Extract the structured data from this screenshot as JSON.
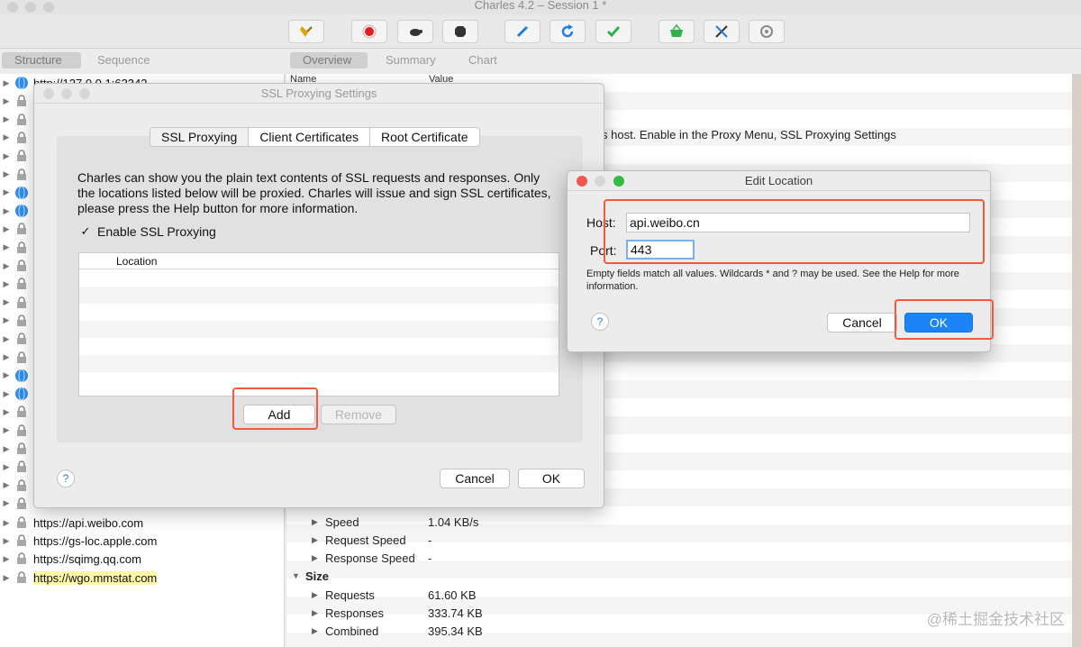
{
  "window": {
    "title": "Charles 4.2 – Session 1 *"
  },
  "toolbar": {
    "buttons": [
      {
        "name": "broom-icon",
        "color": "#e4a400"
      },
      {
        "name": "record-icon",
        "color": "#e02020"
      },
      {
        "name": "turtle-icon",
        "color": "#333333"
      },
      {
        "name": "stop-icon",
        "color": "#333333"
      },
      {
        "name": "pen-icon",
        "color": "#1d7ee0"
      },
      {
        "name": "refresh-icon",
        "color": "#1d7ee0"
      },
      {
        "name": "check-icon",
        "color": "#2db34a"
      },
      {
        "name": "basket-icon",
        "color": "#2db34a"
      },
      {
        "name": "tools-icon",
        "color": "#333333"
      },
      {
        "name": "settings-icon",
        "color": "#888888"
      }
    ]
  },
  "left_tabs": [
    "Structure",
    "Sequence"
  ],
  "right_tabs": [
    "Overview",
    "Summary",
    "Chart"
  ],
  "tree": {
    "top_item": "http://127.0.0.1:63342",
    "items": [
      {
        "label": "https://api.weibo.com",
        "icon": "lock-icon",
        "highlight": false
      },
      {
        "label": "https://gs-loc.apple.com",
        "icon": "lock-icon",
        "highlight": false
      },
      {
        "label": "https://sqimg.qq.com",
        "icon": "lock-icon",
        "highlight": false
      },
      {
        "label": "https://wgo.mmstat.com",
        "icon": "lock-icon",
        "highlight": true
      }
    ]
  },
  "overview": {
    "col_name": "Name",
    "col_value": "Value",
    "hint": "s host. Enable in the Proxy Menu, SSL Proxying Settings",
    "rows": [
      {
        "key": "Speed",
        "value": "1.04 KB/s",
        "level": 1
      },
      {
        "key": "Request Speed",
        "value": "-",
        "level": 1
      },
      {
        "key": "Response Speed",
        "value": "-",
        "level": 1
      },
      {
        "key": "Size",
        "value": "",
        "level": 0
      },
      {
        "key": "Requests",
        "value": "61.60 KB",
        "level": 1
      },
      {
        "key": "Responses",
        "value": "333.74 KB",
        "level": 1
      },
      {
        "key": "Combined",
        "value": "395.34 KB",
        "level": 1
      }
    ]
  },
  "ssl_dialog": {
    "title": "SSL Proxying Settings",
    "tabs": [
      "SSL Proxying",
      "Client Certificates",
      "Root Certificate"
    ],
    "description": "Charles can show you the plain text contents of SSL requests and responses. Only the locations listed below will be proxied. Charles will issue and sign SSL certificates, please press the Help button for more information.",
    "enable_label": "Enable SSL Proxying",
    "enable_checked": true,
    "location_header": "Location",
    "add_label": "Add",
    "remove_label": "Remove",
    "cancel_label": "Cancel",
    "ok_label": "OK",
    "help_label": "?"
  },
  "edit_dialog": {
    "title": "Edit Location",
    "host_label": "Host:",
    "host_value": "api.weibo.cn",
    "port_label": "Port:",
    "port_value": "443",
    "hint": "Empty fields match all values. Wildcards * and ? may be used. See the Help for more information.",
    "cancel_label": "Cancel",
    "ok_label": "OK",
    "help_label": "?"
  },
  "watermark": "@稀土掘金技术社区",
  "colors": {
    "annotation": "#ef5b3c",
    "primary_button": "#1b84f6",
    "highlight": "#fff7a8"
  }
}
